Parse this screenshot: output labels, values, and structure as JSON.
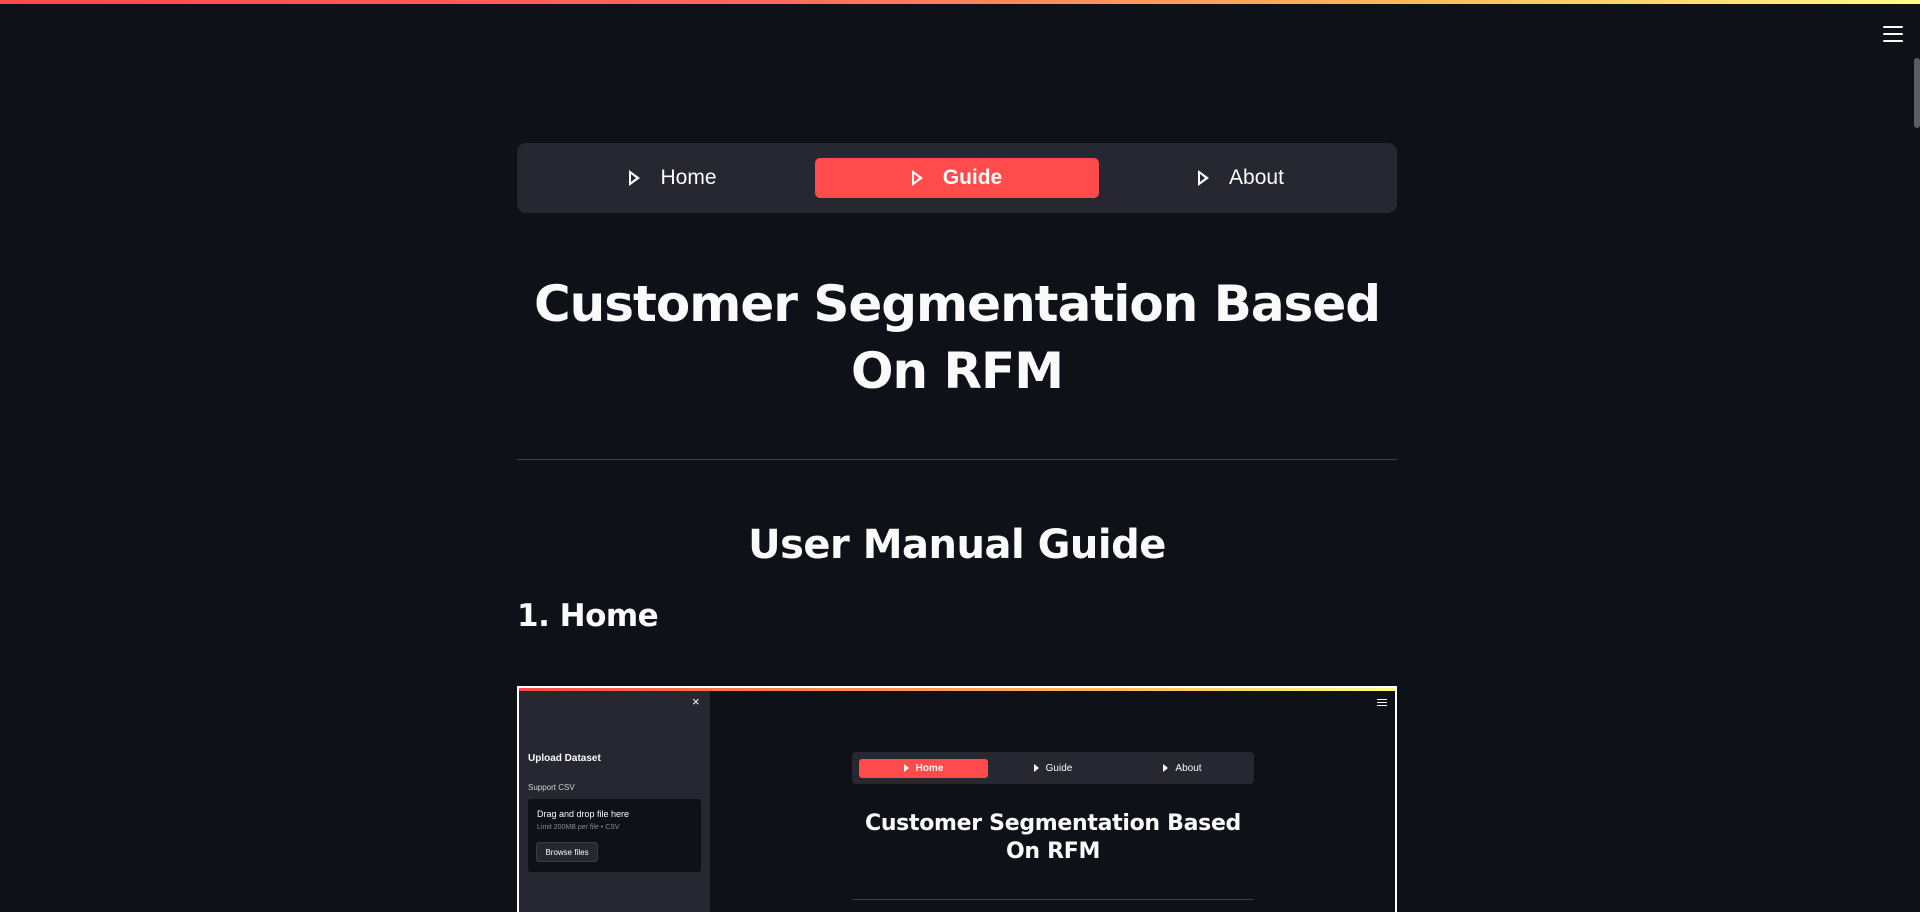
{
  "nav": {
    "items": [
      {
        "label": "Home",
        "active": false
      },
      {
        "label": "Guide",
        "active": true
      },
      {
        "label": "About",
        "active": false
      }
    ]
  },
  "main": {
    "title": "Customer Segmentation Based On RFM",
    "section_title": "User Manual Guide",
    "subsection_title": "1. Home"
  },
  "screenshot": {
    "sidebar": {
      "upload_title": "Upload Dataset",
      "support_text": "Support CSV",
      "drag_text": "Drag and drop file here",
      "limit_text": "Limit 200MB per file • CSV",
      "browse_label": "Browse files",
      "close_glyph": "×"
    },
    "nav": {
      "items": [
        {
          "label": "Home",
          "active": true
        },
        {
          "label": "Guide",
          "active": false
        },
        {
          "label": "About",
          "active": false
        }
      ]
    },
    "title": "Customer Segmentation Based On RFM"
  },
  "colors": {
    "background": "#0e1117",
    "accent": "#ff4b4b",
    "panel": "#262730"
  },
  "icons": {
    "menu": "hamburger-menu-icon",
    "nav": "play-outline-icon"
  }
}
